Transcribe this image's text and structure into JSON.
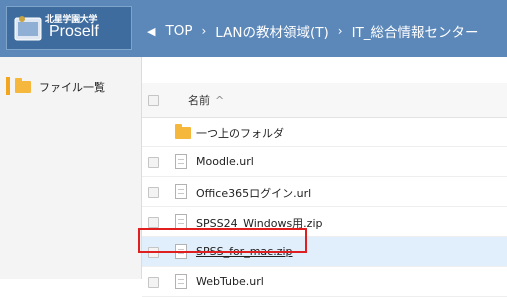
{
  "app": {
    "org_name": "北星学園大学",
    "product_name": "Proself"
  },
  "breadcrumb": {
    "back_icon": "chevron-left-icon",
    "separator": "›",
    "items": [
      "TOP",
      "LANの教材領域(T)",
      "IT_総合情報センター"
    ]
  },
  "sidebar": {
    "items": [
      {
        "label": "ファイル一覧",
        "icon": "folder-icon",
        "active": true
      }
    ]
  },
  "file_list": {
    "header": {
      "name_label": "名前",
      "sort_indicator": "^"
    },
    "rows": [
      {
        "name": "一つ上のフォルダ",
        "type": "folder"
      },
      {
        "name": "Moodle.url",
        "type": "file"
      },
      {
        "name": "Office365ログイン.url",
        "type": "file"
      },
      {
        "name": "SPSS24_Windows用.zip",
        "type": "file"
      },
      {
        "name": "SPSS_for_mac.zip",
        "type": "file",
        "selected": true,
        "highlighted": true
      },
      {
        "name": "WebTube.url",
        "type": "file"
      }
    ]
  },
  "colors": {
    "topbar": "#5b87b9",
    "folder": "#f5b83c",
    "highlight_border": "#e02020",
    "selected_row": "#e1eefb"
  }
}
